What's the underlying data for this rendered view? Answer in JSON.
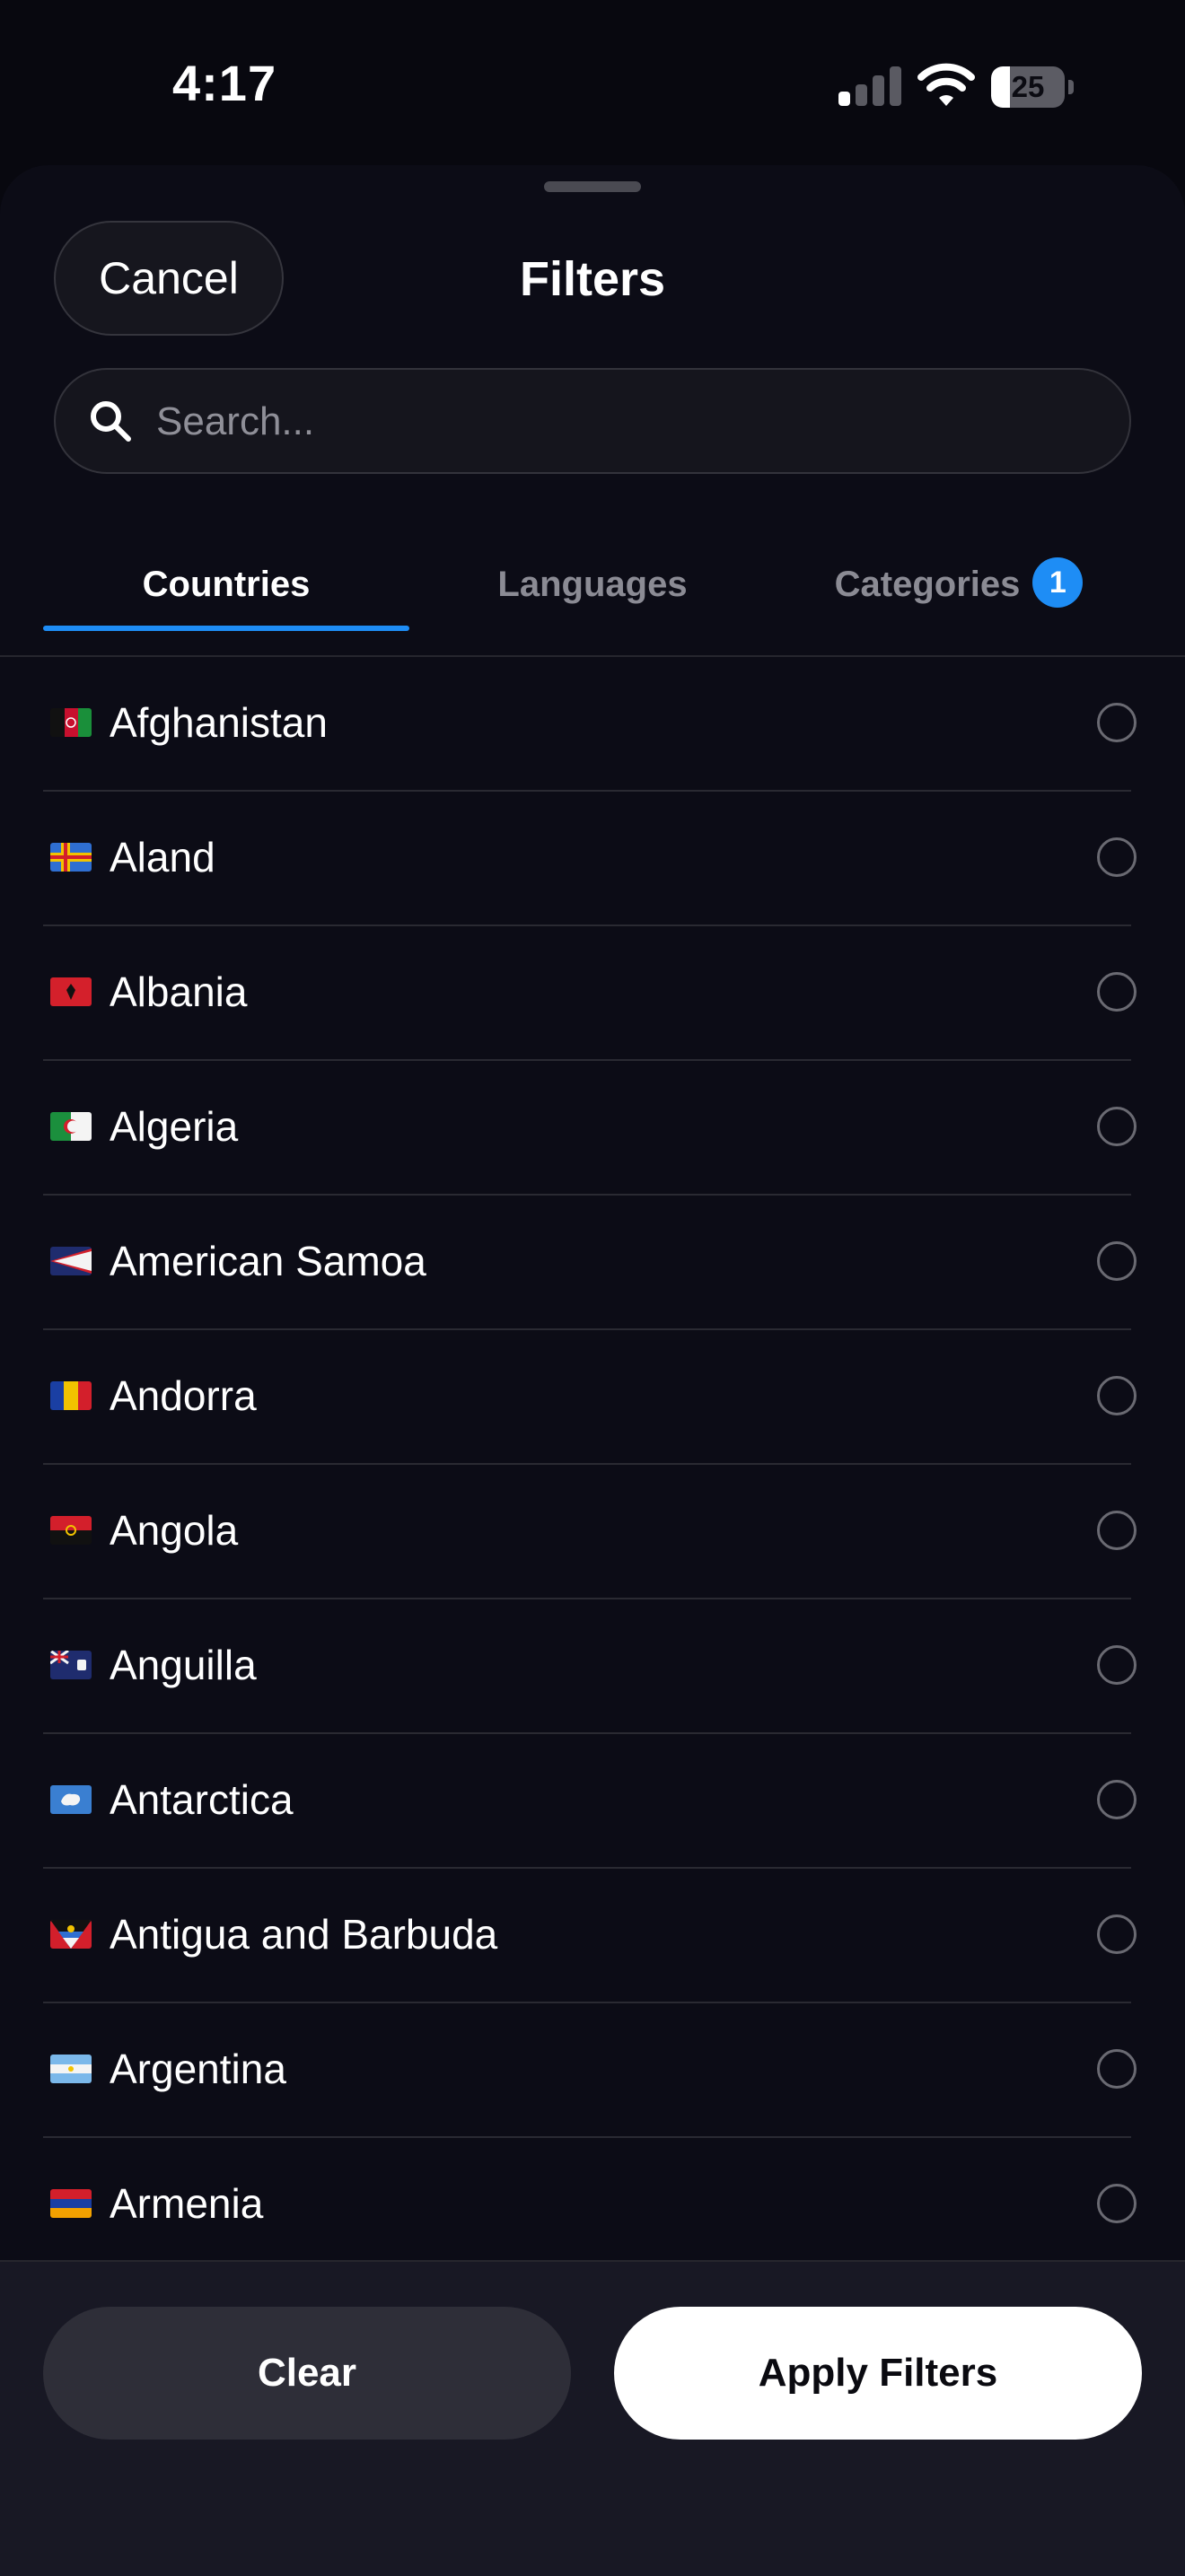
{
  "status_bar": {
    "time": "4:17",
    "battery_level": "25",
    "signal_bars_active": 1,
    "signal_bars_total": 4,
    "icons": [
      "signal-icon",
      "wifi-icon",
      "battery-icon"
    ]
  },
  "sheet": {
    "title": "Filters",
    "cancel_label": "Cancel"
  },
  "search": {
    "placeholder": "Search...",
    "value": "",
    "icon": "search-icon"
  },
  "tabs": [
    {
      "label": "Countries",
      "active": true
    },
    {
      "label": "Languages",
      "active": false
    },
    {
      "label": "Categories",
      "active": false,
      "badge": "1"
    }
  ],
  "countries": [
    {
      "name": "Afghanistan",
      "flag_icon": "flag-afghanistan-icon",
      "selected": false
    },
    {
      "name": "Aland",
      "flag_icon": "flag-aland-icon",
      "selected": false
    },
    {
      "name": "Albania",
      "flag_icon": "flag-albania-icon",
      "selected": false
    },
    {
      "name": "Algeria",
      "flag_icon": "flag-algeria-icon",
      "selected": false
    },
    {
      "name": "American Samoa",
      "flag_icon": "flag-american-samoa-icon",
      "selected": false
    },
    {
      "name": "Andorra",
      "flag_icon": "flag-andorra-icon",
      "selected": false
    },
    {
      "name": "Angola",
      "flag_icon": "flag-angola-icon",
      "selected": false
    },
    {
      "name": "Anguilla",
      "flag_icon": "flag-anguilla-icon",
      "selected": false
    },
    {
      "name": "Antarctica",
      "flag_icon": "flag-antarctica-icon",
      "selected": false
    },
    {
      "name": "Antigua and Barbuda",
      "flag_icon": "flag-antigua-barbuda-icon",
      "selected": false
    },
    {
      "name": "Argentina",
      "flag_icon": "flag-argentina-icon",
      "selected": false
    },
    {
      "name": "Armenia",
      "flag_icon": "flag-armenia-icon",
      "selected": false
    }
  ],
  "footer": {
    "clear_label": "Clear",
    "apply_label": "Apply Filters"
  },
  "colors": {
    "background": "#08080f",
    "sheet": "#0c0c16",
    "accent": "#1e8df5",
    "apply_button": "#ffffff",
    "clear_button": "#2e2e38"
  }
}
